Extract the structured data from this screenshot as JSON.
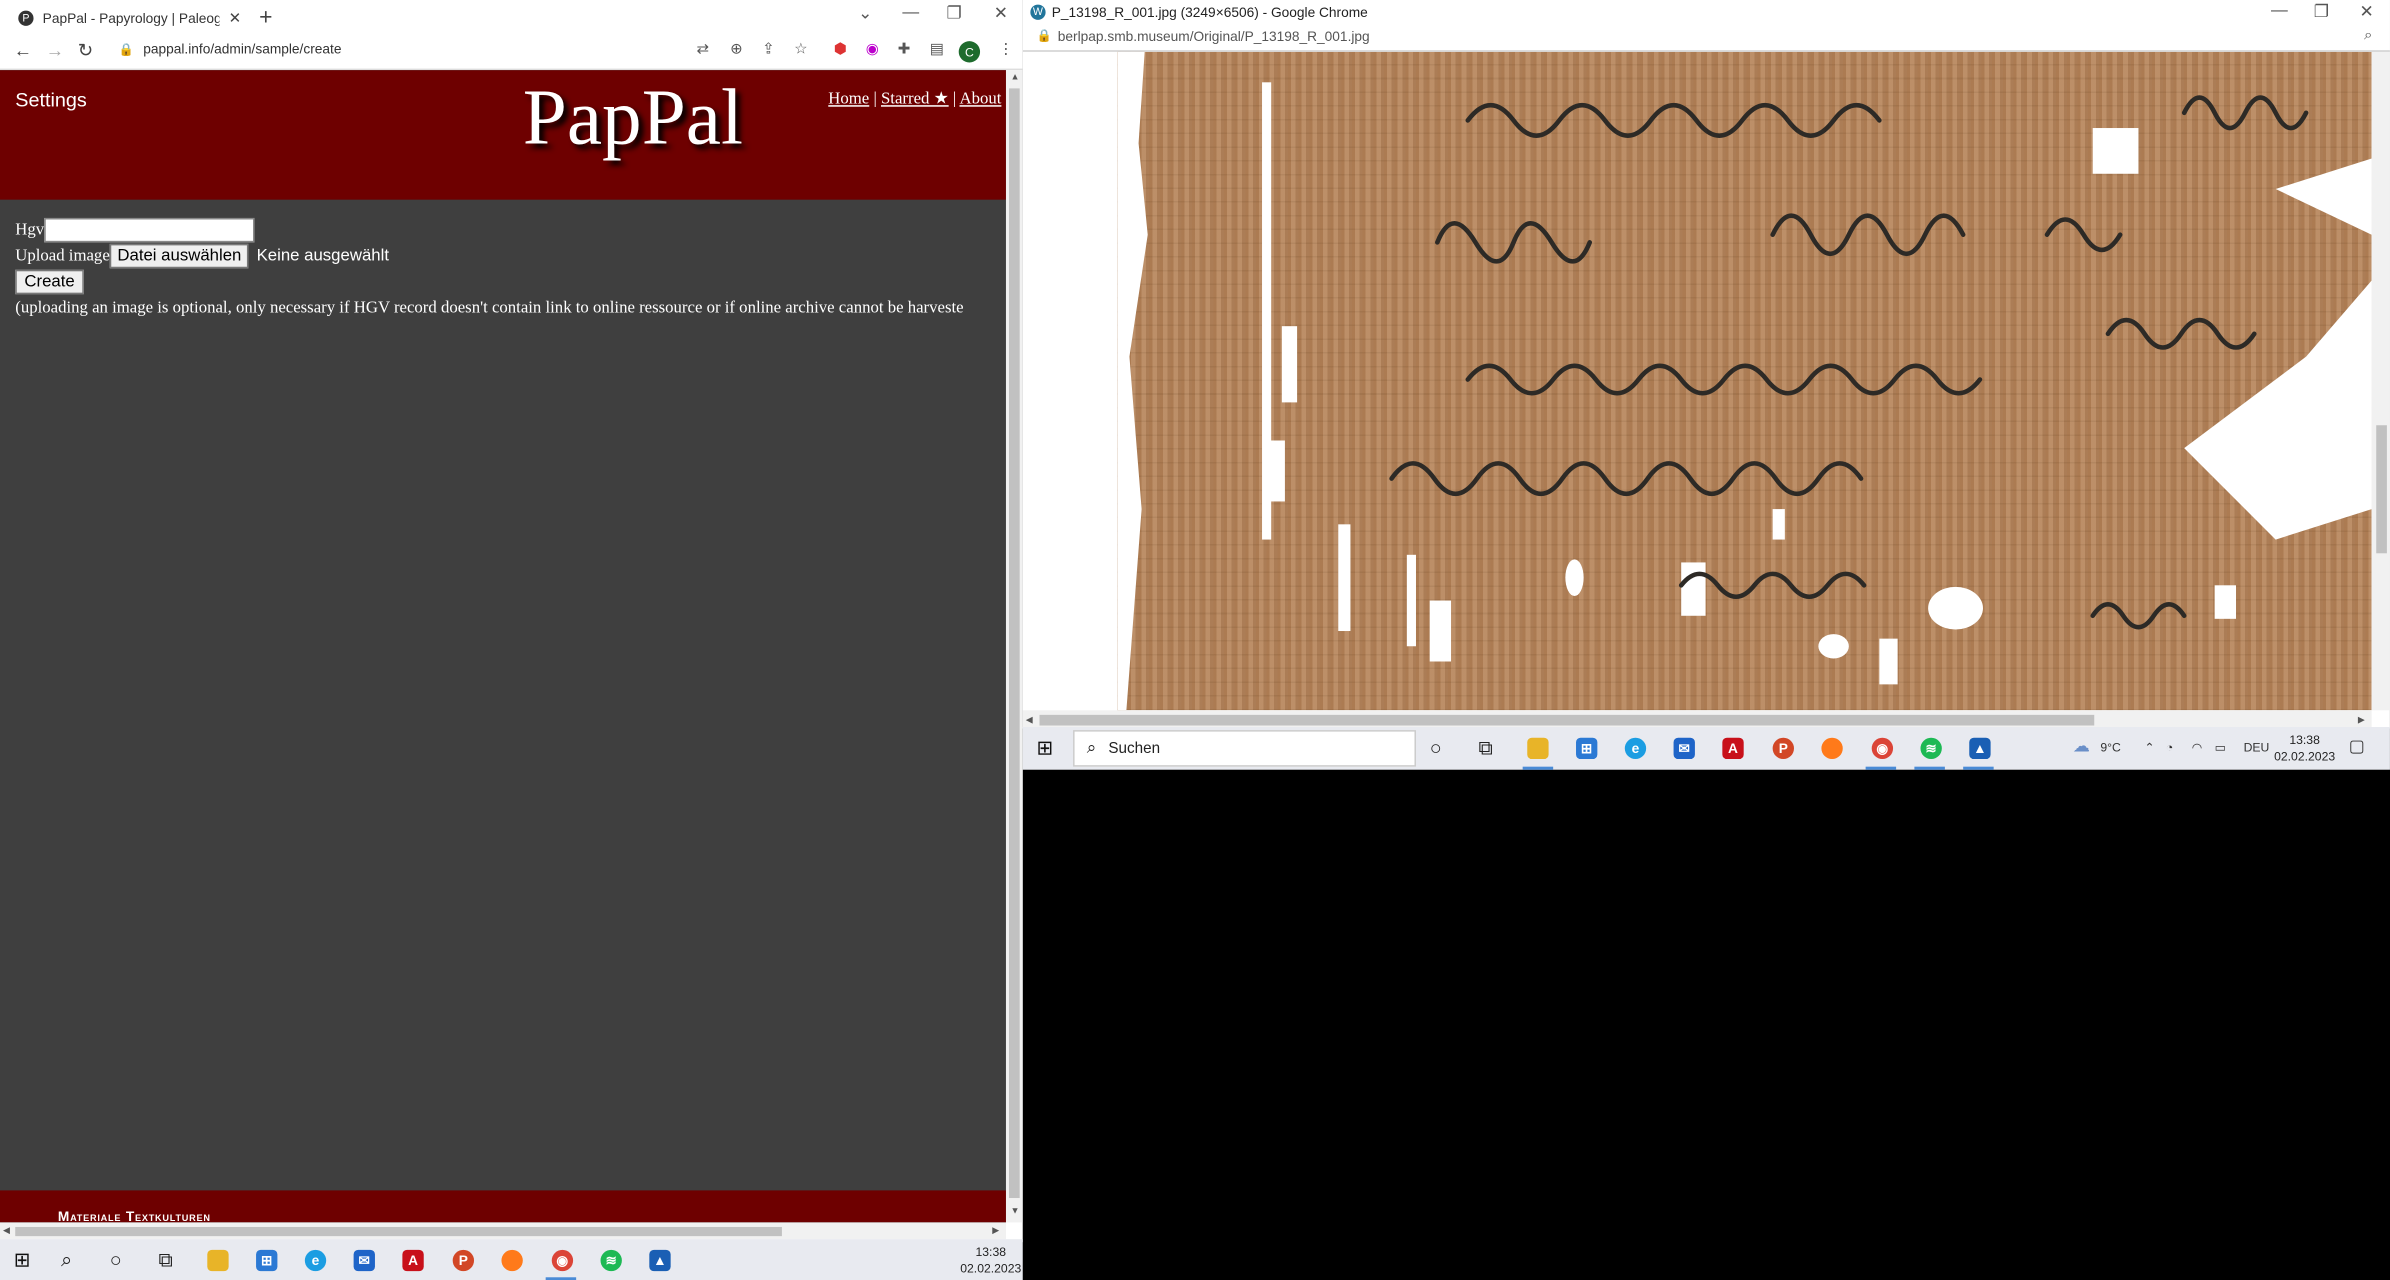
{
  "left_browser": {
    "tab_title": "PapPal - Papyrology | Paleograph",
    "url": "pappal.info/admin/sample/create",
    "profile_initial": "C"
  },
  "site": {
    "settings_label": "Settings",
    "logo": "PapPal",
    "nav": {
      "home": "Home",
      "sep1": " | ",
      "starred": "Starred ★",
      "sep2": " | ",
      "about": "About"
    },
    "form": {
      "hgv_label": "Hgv",
      "hgv_value": "",
      "upload_label": "Upload image",
      "choose_file_button": "Datei auswählen",
      "no_file_text": "Keine ausgewählt",
      "create_button": "Create",
      "note": "(uploading an image is optional, only necessary if HGV record doesn't contain link to online ressource or if online archive cannot be harveste"
    },
    "footer_text": "Materiale Textkulturen"
  },
  "right_browser": {
    "window_title": "P_13198_R_001.jpg (3249×6506) - Google Chrome",
    "url": "berlpap.smb.museum/Original/P_13198_R_001.jpg"
  },
  "taskbar_right": {
    "search_placeholder": "Suchen",
    "weather": "9°C",
    "language": "DEU",
    "time": "13:38",
    "date": "02.02.2023"
  },
  "taskbar_left": {
    "time": "13:38",
    "date": "02.02.2023"
  },
  "colors": {
    "banner": "#6e0000",
    "page_bg": "#3f3f3f",
    "papyrus": "#b7875e",
    "taskbar": "#e8eaf0"
  }
}
